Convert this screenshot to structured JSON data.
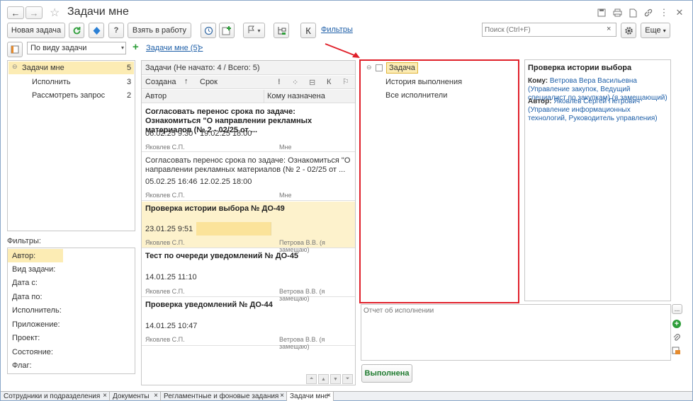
{
  "title": "Задачи мне",
  "toolbar": {
    "new_task": "Новая задача",
    "take_to_work": "Взять в работу",
    "k_label": "К",
    "filters_link": "Фильтры",
    "search_placeholder": "Поиск (Ctrl+F)",
    "more_label": "Еще",
    "more_arrow": "▾",
    "clear_search": "×",
    "dropdown_arrow": "▾"
  },
  "row2": {
    "grouping_value": "По виду задачи",
    "add_symbol": "+",
    "tasks_link": "Задачи мне (5)",
    "link_arrow": ">"
  },
  "tree": {
    "items": [
      {
        "label": "Задачи мне",
        "count": "5"
      },
      {
        "label": "Исполнить",
        "count": "3"
      },
      {
        "label": "Рассмотреть запрос",
        "count": "2"
      }
    ]
  },
  "filters": {
    "title": "Фильтры:",
    "items": [
      "Автор:",
      "Вид задачи:",
      "Дата с:",
      "Дата по:",
      "Исполнитель:",
      "Приложение:",
      "Проект:",
      "Состояние:",
      "Флаг:"
    ]
  },
  "task_list": {
    "header": "Задачи (Не начато: 4 / Всего: 5)",
    "col_created": "Создана",
    "sort_arrow": "↑",
    "col_deadline": "Срок",
    "col_author": "Автор",
    "col_assignee": "Кому назначена",
    "k_col": "К",
    "tasks": [
      {
        "title": "Согласовать перенос срока по задаче: Ознакомиться \"О направлении рекламных материалов (№ 2 - 02/25 от ...",
        "created": "06.02.25 9:30",
        "deadline": "19.02.25 18:00",
        "author": "Яковлев С.П.",
        "assignee": "Мне"
      },
      {
        "title": "Согласовать перенос срока по задаче: Ознакомиться  \"О направлении рекламных материалов (№ 2 - 02/25 от ...",
        "created": "05.02.25 16:46",
        "deadline": "12.02.25 18:00",
        "author": "Яковлев С.П.",
        "assignee": "Мне"
      },
      {
        "title": "Проверка истории выбора № ДО-49",
        "created": "23.01.25 9:51",
        "deadline": "",
        "author": "Яковлев С.П.",
        "assignee": "Петрова В.В. (я замещаю)"
      },
      {
        "title": "Тест по очереди уведомлений № ДО-45",
        "created": "14.01.25 11:10",
        "deadline": "",
        "author": "Яковлев С.П.",
        "assignee": "Ветрова В.В. (я замещаю)"
      },
      {
        "title": "Проверка уведомлений № ДО-44",
        "created": "14.01.25 10:47",
        "deadline": "",
        "author": "Яковлев С.П.",
        "assignee": "Ветрова В.В. (я замещаю)"
      }
    ]
  },
  "detail_tree": {
    "items": [
      "Задача",
      "История выполнения",
      "Все исполнители"
    ]
  },
  "info": {
    "title": "Проверка истории выбора",
    "to_label": "Кому:",
    "to_value": "Ветрова Вера Васильевна (Управление закупок, Ведущий специалист по закупкам) (я замещающий)",
    "author_label": "Автор:",
    "author_value": "Яковлев Сергей Петрович (Управление информационных технологий, Руководитель управления)"
  },
  "report": {
    "placeholder": "Отчет об исполнении",
    "ellipsis": "...",
    "done_button": "Выполнена"
  },
  "tabs": [
    {
      "label": "Сотрудники и подразделения"
    },
    {
      "label": "Документы"
    },
    {
      "label": "Регламентные и фоновые задания"
    },
    {
      "label": "Задачи мне"
    }
  ],
  "tab_close": "×",
  "colors": {
    "accent_green": "#2e9e3a",
    "selection": "#fcecb4",
    "highlight_red": "#e0202a",
    "link": "#1e5fa8"
  }
}
